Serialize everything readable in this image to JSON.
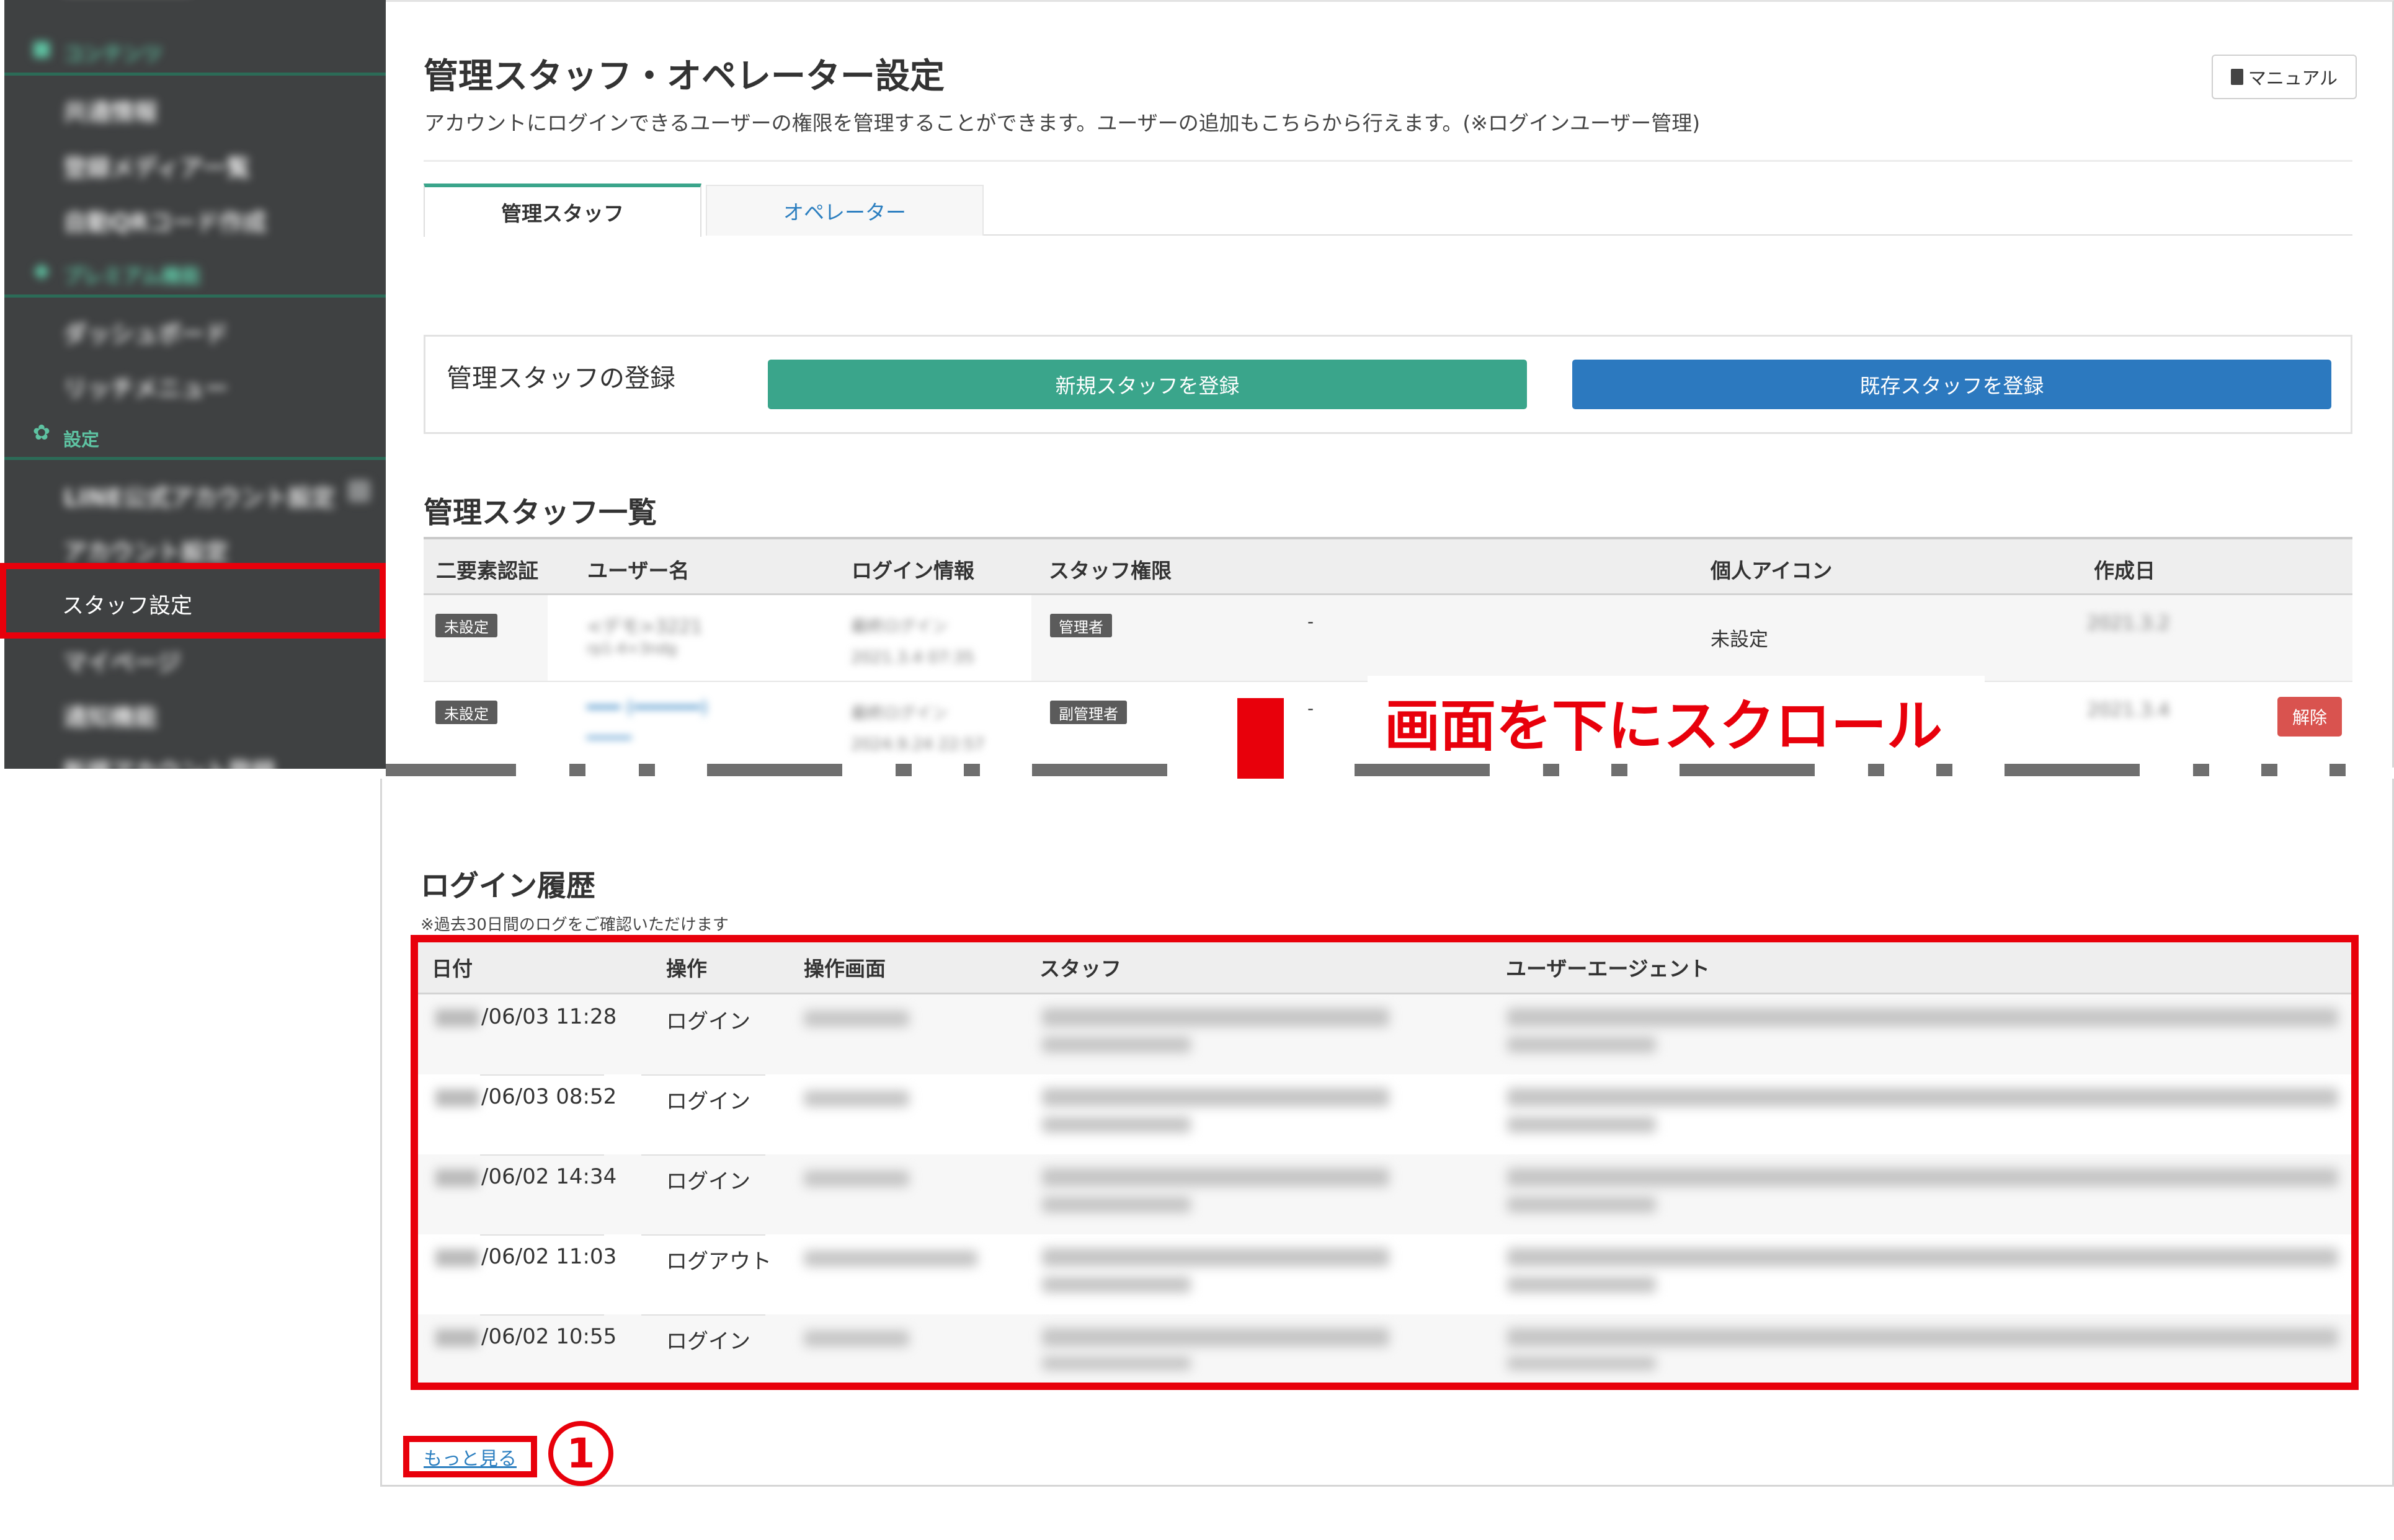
{
  "sidebar": {
    "sections": [
      {
        "label": "コンテンツ",
        "icon": "folder-icon"
      },
      {
        "label": "プレミアム機能",
        "icon": "premium-icon"
      },
      {
        "label": "設定",
        "icon": "gear-icon"
      }
    ],
    "items": [
      {
        "label": "共通情報"
      },
      {
        "label": "登録メディア一覧"
      },
      {
        "label": "自動QRコード作成"
      },
      {
        "label": "ダッシュボード"
      },
      {
        "label": "リッチメニュー"
      },
      {
        "label": "LINE公式アカウント設定"
      },
      {
        "label": "アカウント設定"
      },
      {
        "label": "スタッフ設定"
      },
      {
        "label": "マイページ"
      },
      {
        "label": "通知機能"
      },
      {
        "label": "新規アカウント登録"
      }
    ]
  },
  "header": {
    "title": "管理スタッフ・オペレーター設定",
    "description": "アカウントにログインできるユーザーの権限を管理することができます。ユーザーの追加もこちらから行えます。(※ログインユーザー管理)",
    "manual_label": "マニュアル"
  },
  "tabs": [
    {
      "label": "管理スタッフ",
      "active": true
    },
    {
      "label": "オペレーター",
      "active": false
    }
  ],
  "registration": {
    "label": "管理スタッフの登録",
    "new_button": "新規スタッフを登録",
    "existing_button": "既存スタッフを登録"
  },
  "staff_list": {
    "title": "管理スタッフ一覧",
    "columns": [
      "二要素認証",
      "ユーザー名",
      "ログイン情報",
      "スタッフ権限",
      "個人アイコン",
      "作成日"
    ],
    "rows": [
      {
        "two_factor": "未設定",
        "name": "<デモ>3221",
        "login_info": "最終ログイン 2021.3.4 07:35",
        "role": "管理者",
        "dash": "-",
        "icon": "未設定",
        "created": "2021.3.2"
      },
      {
        "two_factor": "未設定",
        "name": "",
        "login_info": "最終ログイン 2024.9.24 22:57",
        "role": "副管理者",
        "dash": "-",
        "icon": "",
        "created": "2021.3.4",
        "action": "解除"
      }
    ]
  },
  "annotation": {
    "scroll_text": "画面を下にスクロール",
    "step_number": "1"
  },
  "login_history": {
    "title": "ログイン履歴",
    "note": "※過去30日間のログをご確認いただけます",
    "columns": [
      "日付",
      "操作",
      "操作画面",
      "スタッフ",
      "ユーザーエージェント"
    ],
    "rows": [
      {
        "date": "/06/03 11:28",
        "operation": "ログイン"
      },
      {
        "date": "/06/03 08:52",
        "operation": "ログイン"
      },
      {
        "date": "/06/02 14:34",
        "operation": "ログイン"
      },
      {
        "date": "/06/02 11:03",
        "operation": "ログアウト"
      },
      {
        "date": "/06/02 10:55",
        "operation": "ログイン"
      }
    ],
    "more_label": "もっと見る"
  },
  "colors": {
    "accent_green": "#3aa58b",
    "accent_blue": "#2c79bf",
    "annotation_red": "#e8000b",
    "danger": "#d9534f",
    "sidebar_bg": "#3f4142"
  }
}
